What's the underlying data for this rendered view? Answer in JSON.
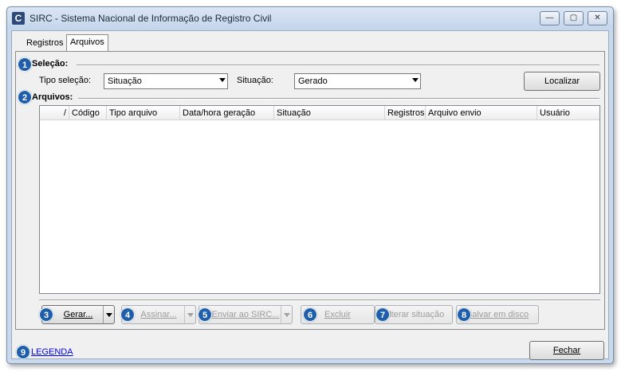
{
  "window": {
    "title": "SIRC - Sistema Nacional de Informação de Registro Civil",
    "app_icon_letter": "C",
    "minimize_glyph": "—",
    "maximize_glyph": "▢",
    "close_glyph": "✕"
  },
  "tabs": [
    {
      "label": "Registros"
    },
    {
      "label": "Arquivos"
    }
  ],
  "selecao": {
    "badge": "1",
    "title": "Seleção:",
    "tipo_label": "Tipo seleção:",
    "tipo_value": "Situação",
    "situacao_label": "Situação:",
    "situacao_value": "Gerado",
    "localizar_button": "Localizar"
  },
  "arquivos": {
    "badge": "2",
    "title": "Arquivos:",
    "columns": [
      "/",
      "Código",
      "Tipo arquivo",
      "Data/hora geração",
      "Situação",
      "Registros",
      "Arquivo envio",
      "Usuário"
    ]
  },
  "actions": [
    {
      "badge": "3",
      "label": "Gerar...",
      "enabled": true
    },
    {
      "badge": "4",
      "label": "Assinar...",
      "enabled": false
    },
    {
      "badge": "5",
      "label": "Enviar ao SIRC...",
      "enabled": false
    },
    {
      "badge": "6",
      "label": "Excluir",
      "enabled": false
    },
    {
      "badge": "7",
      "label": "Alterar situação",
      "enabled": false
    },
    {
      "badge": "8",
      "label": "Salvar em disco",
      "enabled": false
    }
  ],
  "footer": {
    "badge": "9",
    "legend_link": "LEGENDA",
    "close_button": "Fechar"
  },
  "colors": {
    "badge": "#1f5eaa",
    "link": "#0000ee",
    "window_frame": "#c9d9ee"
  }
}
